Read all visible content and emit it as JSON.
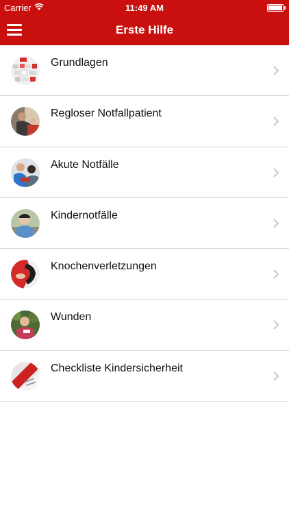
{
  "status": {
    "carrier": "Carrier",
    "time": "11:49 AM",
    "icons": [
      "wifi-icon",
      "battery-icon"
    ]
  },
  "header": {
    "title": "Erste Hilfe",
    "menu_icon": "menu-icon",
    "color": "#c9100f"
  },
  "items": [
    {
      "label": "Grundlagen",
      "thumb": "first-aid-kit-thumbnail"
    },
    {
      "label": "Regloser Notfallpatient",
      "thumb": "unconscious-patient-thumbnail"
    },
    {
      "label": "Akute Notfälle",
      "thumb": "acute-emergency-thumbnail"
    },
    {
      "label": "Kindernotfälle",
      "thumb": "child-emergency-thumbnail"
    },
    {
      "label": "Knochenverletzungen",
      "thumb": "bone-injury-thumbnail"
    },
    {
      "label": "Wunden",
      "thumb": "wounds-thumbnail"
    },
    {
      "label": "Checkliste Kindersicherheit",
      "thumb": "child-safety-checklist-thumbnail"
    }
  ]
}
